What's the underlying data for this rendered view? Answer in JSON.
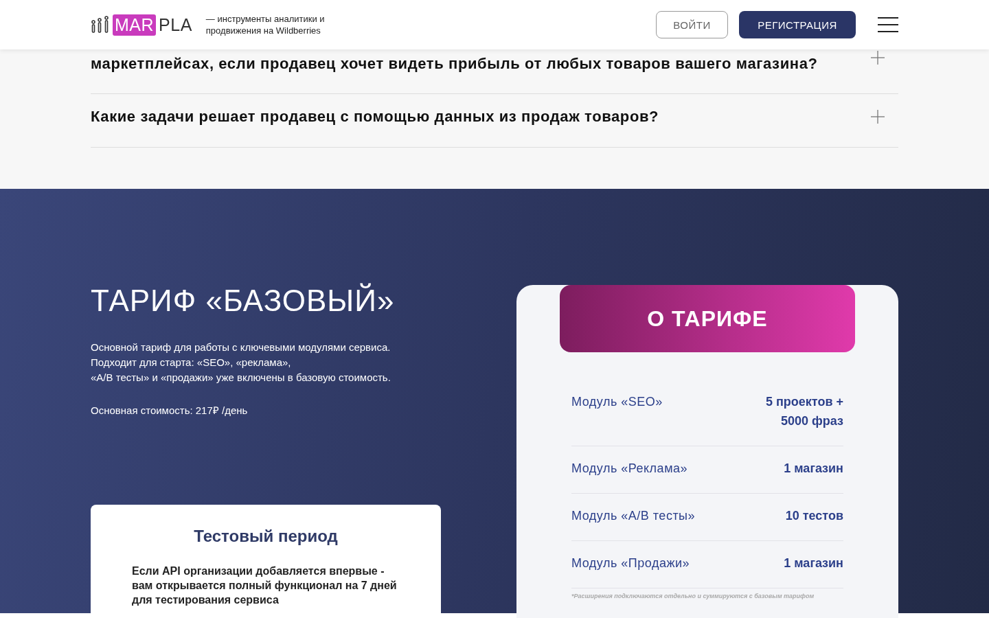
{
  "header": {
    "logo": {
      "mar": "MAR",
      "pla": "PLA"
    },
    "tagline": "— инструменты аналитики и продвижения на Wildberries",
    "buttons": [
      {
        "kind": "outline",
        "label": "ВОЙТИ"
      },
      {
        "kind": "filled",
        "label": "РЕГИСТРАЦИЯ"
      }
    ]
  },
  "faq": {
    "items": [
      {
        "question": "маркетплейсах, если продавец хочет видеть прибыль от любых товаров вашего магазина?",
        "expanded": false
      },
      {
        "question": "Какие задачи решает продавец с помощью данных из продаж товаров?",
        "expanded": false
      }
    ]
  },
  "tariff": {
    "title": "ТАРИФ «БАЗОВЫЙ»",
    "description": [
      "Основной тариф для работы с ключевыми модулями сервиса.",
      "Подходит для старта: «SEO», «реклама»,",
      "«A/B тесты» и «продажи» уже включены в базовую стоимость."
    ],
    "price": "Основная стоимость: 217₽ /день",
    "trial": {
      "title": "Тестовый период",
      "text": "Если API организации добавляется впервые - вам открывается полный функционал на 7 дней для тестирования сервиса"
    },
    "about": {
      "badge": "О ТАРИФЕ",
      "rows": [
        {
          "module": "Модуль «SEO»",
          "value": "5 проектов + 5000 фраз"
        },
        {
          "module": "Модуль «Реклама»",
          "value": "1 магазин"
        },
        {
          "module": "Модуль «A/B тесты»",
          "value": "10 тестов"
        },
        {
          "module": "Модуль «Продажи»",
          "value": "1 магазин"
        }
      ],
      "footnote": "*Расширения подключаются отдельно и суммируются с базовым тарифом"
    }
  }
}
